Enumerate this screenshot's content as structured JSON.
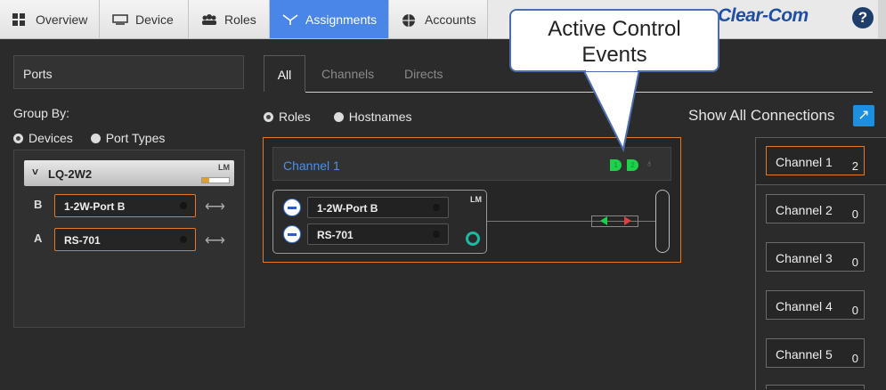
{
  "nav": {
    "tabs": [
      {
        "label": "Overview"
      },
      {
        "label": "Device"
      },
      {
        "label": "Roles"
      },
      {
        "label": "Assignments"
      },
      {
        "label": "Accounts"
      }
    ],
    "active_tab": "Assignments",
    "brand": "Clear-Com",
    "help_label": "?"
  },
  "left": {
    "ports_title": "Ports",
    "group_by_label": "Group By:",
    "group_options": [
      "Devices",
      "Port Types"
    ],
    "device": {
      "name": "LQ-2W2",
      "badge": "LM",
      "ports": [
        {
          "letter": "B",
          "name": "1-2W-Port B"
        },
        {
          "letter": "A",
          "name": "RS-701"
        }
      ]
    }
  },
  "center": {
    "tabs": [
      "All",
      "Channels",
      "Directs"
    ],
    "view_options": [
      "Roles",
      "Hostnames"
    ],
    "channel": {
      "title": "Channel 1",
      "events": [
        "1",
        "2"
      ],
      "badge": "LM",
      "ports": [
        "1-2W-Port B",
        "RS-701"
      ]
    },
    "callout": "Active Control Events"
  },
  "right": {
    "show_all_label": "Show All Connections",
    "channels": [
      {
        "label": "Channel 1",
        "count": "2"
      },
      {
        "label": "Channel 2",
        "count": "0"
      },
      {
        "label": "Channel 3",
        "count": "0"
      },
      {
        "label": "Channel 4",
        "count": "0"
      },
      {
        "label": "Channel 5",
        "count": "0"
      }
    ]
  },
  "colors": {
    "accent": "#4a86e8",
    "highlight": "#e07a2a",
    "event_green": "#1fd14a"
  }
}
